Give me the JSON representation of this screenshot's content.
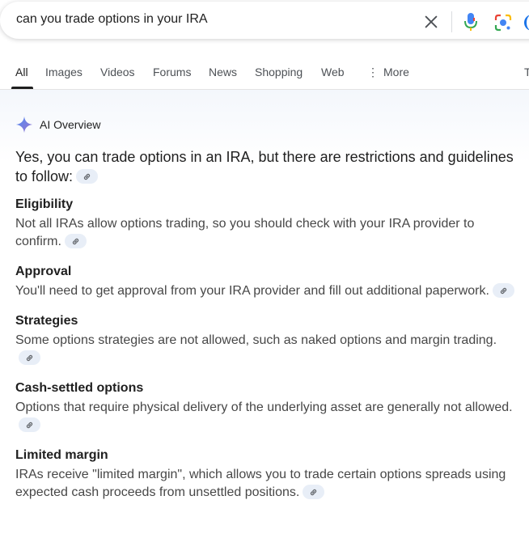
{
  "search": {
    "query": "can you trade options in your IRA",
    "clear_icon": "close-icon",
    "voice_icon": "microphone-icon",
    "lens_icon": "lens-icon"
  },
  "tabs": [
    {
      "label": "All",
      "active": true
    },
    {
      "label": "Images"
    },
    {
      "label": "Videos"
    },
    {
      "label": "Forums"
    },
    {
      "label": "News"
    },
    {
      "label": "Shopping"
    },
    {
      "label": "Web"
    },
    {
      "label": "More",
      "icon": "vertical-dots-icon"
    },
    {
      "label": "T"
    }
  ],
  "ai_overview": {
    "title": "AI Overview",
    "icon": "sparkle-icon",
    "lead": "Yes, you can trade options in an IRA, but there are restrictions and guidelines to follow:",
    "sections": [
      {
        "title": "Eligibility",
        "body": "Not all IRAs allow options trading, so you should check with your IRA provider to confirm."
      },
      {
        "title": "Approval",
        "body": "You'll need to get approval from your IRA provider and fill out additional paperwork."
      },
      {
        "title": "Strategies",
        "body": "Some options strategies are not allowed, such as naked options and margin trading."
      },
      {
        "title": "Cash-settled options",
        "body": "Options that require physical delivery of the underlying asset are generally not allowed."
      },
      {
        "title": "Limited margin",
        "body": "IRAs receive \"limited margin\", which allows you to trade certain options spreads using expected cash proceeds from unsettled positions."
      }
    ]
  },
  "colors": {
    "accent_blue": "#1a73e8",
    "chip_bg": "#e8eef7",
    "text_secondary": "#474747"
  }
}
